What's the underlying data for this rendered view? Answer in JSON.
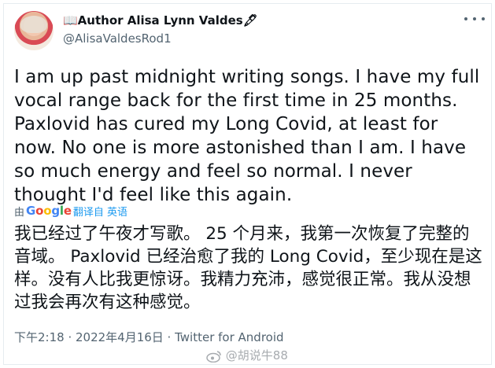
{
  "author": {
    "display_name": "📖Author Alisa Lynn Valdes🖋",
    "handle": "@AlisaValdesRod1"
  },
  "tweet": {
    "text": "I am up past midnight writing songs.  I have my full vocal range back for the first time in 25 months. Paxlovid has cured my Long Covid, at least for now. No one is more astonished than I am. I have so much energy and feel so normal. I never thought I'd feel like this again.",
    "translate_prefix": "由",
    "translate_provider": "Google",
    "translate_link": "翻译自 英语",
    "translation": "我已经过了午夜才写歌。 25 个月来，我第一次恢复了完整的音域。 Paxlovid 已经治愈了我的 Long Covid，至少现在是这样。没有人比我更惊讶。我精力充沛，感觉很正常。我从没想过我会再次有这种感觉。",
    "meta": "下午2:18 · 2022年4月16日 · Twitter for Android"
  },
  "watermark": "@胡说牛88",
  "colors": {
    "text": "#0f1419",
    "secondary": "#536471",
    "link": "#1d9bf0"
  },
  "icons": [
    "more-icon",
    "google-logo",
    "weibo-icon"
  ]
}
